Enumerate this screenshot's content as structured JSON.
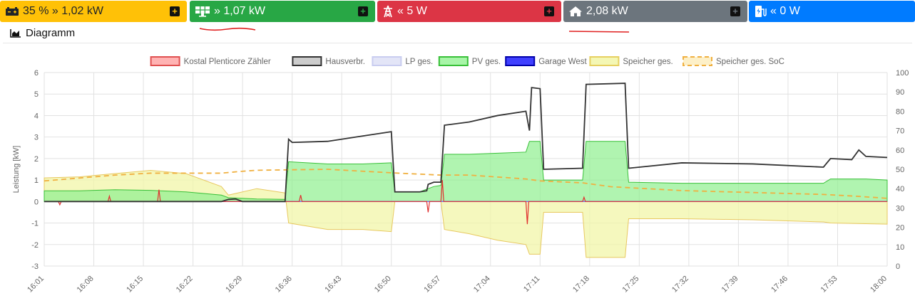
{
  "tiles": [
    {
      "name": "battery",
      "icon": "car-battery-icon",
      "text": "35 % » 1,02 kW",
      "bg": "#ffc107",
      "fg": "#212529"
    },
    {
      "name": "pv",
      "icon": "solar-panel-icon",
      "text": "» 1,07 kW",
      "bg": "#28a745",
      "fg": "#ffffff"
    },
    {
      "name": "grid",
      "icon": "power-tower-icon",
      "text": "« 5 W",
      "bg": "#dc3545",
      "fg": "#ffffff"
    },
    {
      "name": "house",
      "icon": "home-icon",
      "text": "2,08 kW",
      "bg": "#6c757d",
      "fg": "#ffffff"
    },
    {
      "name": "charging",
      "icon": "charging-station-icon",
      "text": "« 0 W",
      "bg": "#007bff",
      "fg": "#ffffff"
    }
  ],
  "section": {
    "title": "Diagramm",
    "icon": "chart-area-icon"
  },
  "chart_data": {
    "type": "area",
    "ylabel": "Leistung [kW]",
    "ylim": [
      -3,
      6
    ],
    "y2lim": [
      0,
      100
    ],
    "yticks": [
      "6",
      "5",
      "4",
      "3",
      "2",
      "1",
      "0",
      "-1",
      "-2",
      "-3"
    ],
    "y2ticks": [
      "100",
      "90",
      "80",
      "70",
      "60",
      "50",
      "40",
      "30",
      "20",
      "10",
      "0"
    ],
    "xticks": [
      "16:01",
      "16:08",
      "16:15",
      "16:22",
      "16:29",
      "16:36",
      "16:43",
      "16:50",
      "16:57",
      "17:04",
      "17:11",
      "17:18",
      "17:25",
      "17:32",
      "17:39",
      "17:46",
      "17:53",
      "18:00"
    ],
    "xrange_min": [
      0,
      119
    ],
    "grid": true,
    "legend_position": "top",
    "legend": [
      {
        "label": "Kostal Plenticore Zähler",
        "fill": "#ffb3b3",
        "stroke": "#e05050",
        "dashed": false
      },
      {
        "label": "Hausverbr.",
        "fill": "#cccccc",
        "stroke": "#333333",
        "dashed": false
      },
      {
        "label": "LP ges.",
        "fill": "#e3e5f7",
        "stroke": "#c9cdf0",
        "dashed": false
      },
      {
        "label": "PV ges.",
        "fill": "#a8f5a8",
        "stroke": "#38c038",
        "dashed": false
      },
      {
        "label": "Garage West",
        "fill": "#4040ff",
        "stroke": "#0000aa",
        "dashed": false
      },
      {
        "label": "Speicher ges.",
        "fill": "#f4f7b4",
        "stroke": "#e6d060",
        "dashed": false
      },
      {
        "label": "Speicher ges. SoC",
        "fill": "#fdf0c8",
        "stroke": "#f0b040",
        "dashed": true
      }
    ],
    "series": {
      "pv": [
        [
          0,
          0.5
        ],
        [
          5,
          0.5
        ],
        [
          10,
          0.55
        ],
        [
          15,
          0.52
        ],
        [
          20,
          0.45
        ],
        [
          25,
          0.3
        ],
        [
          26,
          0.18
        ],
        [
          30,
          0.12
        ],
        [
          34,
          0.1
        ],
        [
          34.5,
          1.85
        ],
        [
          40,
          1.75
        ],
        [
          45,
          1.75
        ],
        [
          49,
          1.8
        ],
        [
          49.5,
          0.45
        ],
        [
          53,
          0.45
        ],
        [
          55,
          0.7
        ],
        [
          56,
          0.75
        ],
        [
          56.5,
          2.2
        ],
        [
          60,
          2.2
        ],
        [
          64,
          2.25
        ],
        [
          68,
          2.3
        ],
        [
          68.5,
          2.8
        ],
        [
          70,
          2.8
        ],
        [
          70.5,
          1.0
        ],
        [
          76,
          1.0
        ],
        [
          76.5,
          2.8
        ],
        [
          82,
          2.8
        ],
        [
          82.5,
          0.9
        ],
        [
          90,
          0.85
        ],
        [
          100,
          0.85
        ],
        [
          110,
          0.85
        ],
        [
          111,
          1.05
        ],
        [
          116,
          1.05
        ],
        [
          119,
          1.0
        ]
      ],
      "house": [
        [
          0,
          0
        ],
        [
          25,
          0
        ],
        [
          26,
          0.1
        ],
        [
          27,
          0.12
        ],
        [
          28,
          0
        ],
        [
          34,
          0
        ],
        [
          34.5,
          2.9
        ],
        [
          35,
          2.75
        ],
        [
          40,
          2.8
        ],
        [
          45,
          3.05
        ],
        [
          49,
          3.25
        ],
        [
          49.5,
          0.45
        ],
        [
          53,
          0.45
        ],
        [
          54,
          0.5
        ],
        [
          54.2,
          0.8
        ],
        [
          55,
          0.9
        ],
        [
          56,
          0.9
        ],
        [
          56.5,
          3.55
        ],
        [
          60,
          3.7
        ],
        [
          64,
          4.0
        ],
        [
          68,
          4.2
        ],
        [
          68.5,
          3.3
        ],
        [
          68.8,
          5.3
        ],
        [
          70,
          5.25
        ],
        [
          70.5,
          1.5
        ],
        [
          76,
          1.55
        ],
        [
          76.5,
          5.45
        ],
        [
          82,
          5.5
        ],
        [
          82.5,
          1.55
        ],
        [
          90,
          1.8
        ],
        [
          100,
          1.75
        ],
        [
          110,
          1.6
        ],
        [
          111,
          2.0
        ],
        [
          114,
          1.95
        ],
        [
          115,
          2.4
        ],
        [
          116,
          2.1
        ],
        [
          119,
          2.05
        ]
      ],
      "storage": [
        [
          0,
          1.1
        ],
        [
          5,
          1.15
        ],
        [
          10,
          1.3
        ],
        [
          15,
          1.45
        ],
        [
          20,
          1.3
        ],
        [
          25,
          0.7
        ],
        [
          26,
          0.3
        ],
        [
          30,
          0.6
        ],
        [
          34,
          0.4
        ],
        [
          34.5,
          -1.0
        ],
        [
          40,
          -1.3
        ],
        [
          45,
          -1.3
        ],
        [
          49,
          -1.4
        ],
        [
          49.5,
          0
        ],
        [
          56,
          0
        ],
        [
          56.5,
          -1.3
        ],
        [
          60,
          -1.5
        ],
        [
          64,
          -1.8
        ],
        [
          68,
          -2.0
        ],
        [
          68.5,
          -2.45
        ],
        [
          70,
          -2.45
        ],
        [
          70.5,
          -0.5
        ],
        [
          76,
          -0.5
        ],
        [
          76.5,
          -2.6
        ],
        [
          82,
          -2.6
        ],
        [
          82.5,
          -0.8
        ],
        [
          90,
          -0.8
        ],
        [
          100,
          -0.85
        ],
        [
          110,
          -0.95
        ],
        [
          111,
          -1.0
        ],
        [
          119,
          -1.05
        ]
      ],
      "grid": [
        [
          0,
          0
        ],
        [
          2,
          0
        ],
        [
          2.2,
          -0.15
        ],
        [
          2.4,
          0
        ],
        [
          9,
          0
        ],
        [
          9.2,
          0.25
        ],
        [
          9.4,
          0
        ],
        [
          16,
          0
        ],
        [
          16.2,
          0.55
        ],
        [
          16.4,
          0
        ],
        [
          36,
          0
        ],
        [
          36.2,
          0.3
        ],
        [
          36.4,
          0
        ],
        [
          54,
          0
        ],
        [
          54.2,
          -0.5
        ],
        [
          54.4,
          0
        ],
        [
          56,
          0
        ],
        [
          56.2,
          1.0
        ],
        [
          56.4,
          0
        ],
        [
          68,
          0
        ],
        [
          68.2,
          -1.05
        ],
        [
          68.4,
          0
        ],
        [
          76,
          0
        ],
        [
          76.2,
          0.2
        ],
        [
          76.4,
          0
        ],
        [
          119,
          0
        ]
      ],
      "soc": [
        [
          0,
          44
        ],
        [
          10,
          47
        ],
        [
          15,
          48
        ],
        [
          25,
          48
        ],
        [
          28,
          49
        ],
        [
          30,
          49.5
        ],
        [
          40,
          50
        ],
        [
          45,
          49
        ],
        [
          50,
          48
        ],
        [
          56,
          47
        ],
        [
          60,
          47
        ],
        [
          64,
          46
        ],
        [
          68,
          45
        ],
        [
          70,
          44
        ],
        [
          76,
          43
        ],
        [
          80,
          41
        ],
        [
          85,
          40
        ],
        [
          90,
          39
        ],
        [
          100,
          38
        ],
        [
          110,
          37
        ],
        [
          115,
          36
        ],
        [
          119,
          35
        ]
      ]
    }
  }
}
